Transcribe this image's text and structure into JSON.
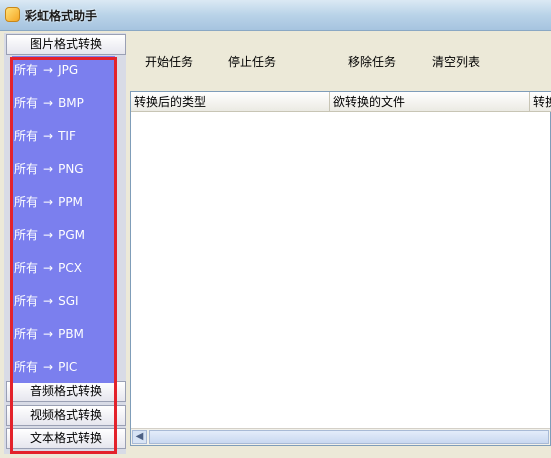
{
  "window": {
    "title": "彩虹格式助手"
  },
  "sidebar": {
    "categories": [
      {
        "label": "图片格式转换"
      },
      {
        "label": "音频格式转换"
      },
      {
        "label": "视频格式转换"
      },
      {
        "label": "文本格式转换"
      }
    ],
    "image_conversions": [
      {
        "from": "所有",
        "arrow": "→",
        "to": "JPG"
      },
      {
        "from": "所有",
        "arrow": "→",
        "to": "BMP"
      },
      {
        "from": "所有",
        "arrow": "→",
        "to": "TIF"
      },
      {
        "from": "所有",
        "arrow": "→",
        "to": "PNG"
      },
      {
        "from": "所有",
        "arrow": "→",
        "to": "PPM"
      },
      {
        "from": "所有",
        "arrow": "→",
        "to": "PGM"
      },
      {
        "from": "所有",
        "arrow": "→",
        "to": "PCX"
      },
      {
        "from": "所有",
        "arrow": "→",
        "to": "SGI"
      },
      {
        "from": "所有",
        "arrow": "→",
        "to": "PBM"
      },
      {
        "from": "所有",
        "arrow": "→",
        "to": "PIC"
      }
    ]
  },
  "toolbar": {
    "start": "开始任务",
    "stop": "停止任务",
    "remove": "移除任务",
    "clear": "清空列表"
  },
  "list": {
    "columns": [
      "转换后的类型",
      "欲转换的文件",
      "转换"
    ]
  },
  "colors": {
    "list_background": "#7b7fee",
    "highlight_border": "#e3222b"
  }
}
